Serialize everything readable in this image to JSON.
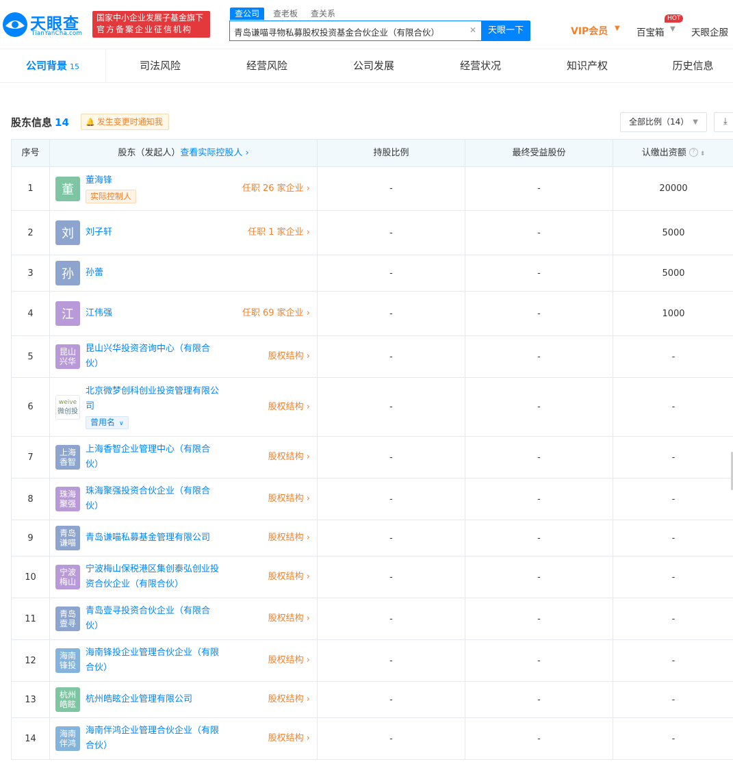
{
  "header": {
    "logo_text": "天眼查",
    "logo_sub": "TianYanCha.com",
    "badge_line1": "国家中小企业发展子基金旗下",
    "badge_line2": "官方备案企业征信机构",
    "search_tabs": [
      "查公司",
      "查老板",
      "查关系"
    ],
    "search_value": "青岛谦喵寻物私募股权投资基金合伙企业（有限合伙）",
    "search_button": "天眼一下",
    "vip": "VIP会员",
    "hot": "HOT",
    "baobaoxiang": "百宝箱",
    "qifu": "天眼企服",
    "brand_color": "#0084ff",
    "accent_color": "#f6802b"
  },
  "nav": {
    "tabs": [
      {
        "label": "公司背景",
        "count": "15"
      },
      {
        "label": "司法风险"
      },
      {
        "label": "经营风险"
      },
      {
        "label": "公司发展"
      },
      {
        "label": "经营状况"
      },
      {
        "label": "知识产权"
      },
      {
        "label": "历史信息"
      }
    ]
  },
  "section": {
    "title": "股东信息",
    "count": "14",
    "notify": "发生变更时通知我",
    "ratio_filter": "全部比例（14）"
  },
  "table": {
    "headers": {
      "idx": "序号",
      "holder": "股东（发起人）",
      "holder_link": "查看实际控股人",
      "ratio": "持股比例",
      "final": "最终受益股份",
      "amount": "认缴出资额"
    },
    "rows": [
      {
        "idx": "1",
        "avatar": "董",
        "avatar_color": "#7fc5a3",
        "name_lines": [
          "董海锋"
        ],
        "tag_actual": "实际控制人",
        "action": "任职 26 家企业",
        "ratio": "-",
        "final": "-",
        "amount": "20000"
      },
      {
        "idx": "2",
        "avatar": "刘",
        "avatar_color": "#8da4cf",
        "name_lines": [
          "刘子轩"
        ],
        "action": "任职 1 家企业",
        "ratio": "-",
        "final": "-",
        "amount": "5000"
      },
      {
        "idx": "3",
        "avatar": "孙",
        "avatar_color": "#8da4cf",
        "name_lines": [
          "孙蕾"
        ],
        "ratio": "-",
        "final": "-",
        "amount": "5000"
      },
      {
        "idx": "4",
        "avatar": "江",
        "avatar_color": "#b99ad9",
        "name_lines": [
          "江伟强"
        ],
        "action": "任职 69 家企业",
        "ratio": "-",
        "final": "-",
        "amount": "1000"
      },
      {
        "idx": "5",
        "avatar_lines": [
          "昆山",
          "兴华"
        ],
        "avatar_color": "#b99ad9",
        "name_lines": [
          "昆山兴华投资咨询中心（有限合",
          "伙）"
        ],
        "action": "股权结构",
        "ratio": "-",
        "final": "-",
        "amount": "-"
      },
      {
        "idx": "6",
        "avatar_lines": [
          "weive",
          "微创投"
        ],
        "avatar_color": "#ffffff",
        "name_lines": [
          "北京微梦创科创业投资管理有限公",
          "司"
        ],
        "tag_former": "曾用名",
        "action": "股权结构",
        "ratio": "-",
        "final": "-",
        "amount": "-"
      },
      {
        "idx": "7",
        "avatar_lines": [
          "上海",
          "香智"
        ],
        "avatar_color": "#8da4cf",
        "name_lines": [
          "上海香智企业管理中心（有限合",
          "伙）"
        ],
        "action": "股权结构",
        "ratio": "-",
        "final": "-",
        "amount": "-"
      },
      {
        "idx": "8",
        "avatar_lines": [
          "珠海",
          "聚强"
        ],
        "avatar_color": "#b99ad9",
        "name_lines": [
          "珠海聚强投资合伙企业（有限合",
          "伙）"
        ],
        "action": "股权结构",
        "ratio": "-",
        "final": "-",
        "amount": "-"
      },
      {
        "idx": "9",
        "avatar_lines": [
          "青岛",
          "谦喵"
        ],
        "avatar_color": "#8da4cf",
        "name_lines": [
          "青岛谦喵私募基金管理有限公司"
        ],
        "action": "股权结构",
        "ratio": "-",
        "final": "-",
        "amount": "-"
      },
      {
        "idx": "10",
        "avatar_lines": [
          "宁波",
          "梅山"
        ],
        "avatar_color": "#b99ad9",
        "name_lines": [
          "宁波梅山保税港区集创泰弘创业投",
          "资合伙企业（有限合伙）"
        ],
        "action": "股权结构",
        "ratio": "-",
        "final": "-",
        "amount": "-"
      },
      {
        "idx": "11",
        "avatar_lines": [
          "青岛",
          "壹寻"
        ],
        "avatar_color": "#8da4cf",
        "name_lines": [
          "青岛壹寻投资合伙企业（有限合",
          "伙）"
        ],
        "action": "股权结构",
        "ratio": "-",
        "final": "-",
        "amount": "-"
      },
      {
        "idx": "12",
        "avatar_lines": [
          "海南",
          "锋投"
        ],
        "avatar_color": "#84b3dc",
        "name_lines": [
          "海南锋投企业管理合伙企业（有限",
          "合伙）"
        ],
        "action": "股权结构",
        "ratio": "-",
        "final": "-",
        "amount": "-"
      },
      {
        "idx": "13",
        "avatar_lines": [
          "杭州",
          "皓眩"
        ],
        "avatar_color": "#7fc5a3",
        "name_lines": [
          "杭州皓眩企业管理有限公司"
        ],
        "action": "股权结构",
        "ratio": "-",
        "final": "-",
        "amount": "-"
      },
      {
        "idx": "14",
        "avatar_lines": [
          "海南",
          "伴鸿"
        ],
        "avatar_color": "#84b3dc",
        "name_lines": [
          "海南伴鸿企业管理合伙企业（有限",
          "合伙）"
        ],
        "action": "股权结构",
        "ratio": "-",
        "final": "-",
        "amount": "-"
      }
    ]
  }
}
